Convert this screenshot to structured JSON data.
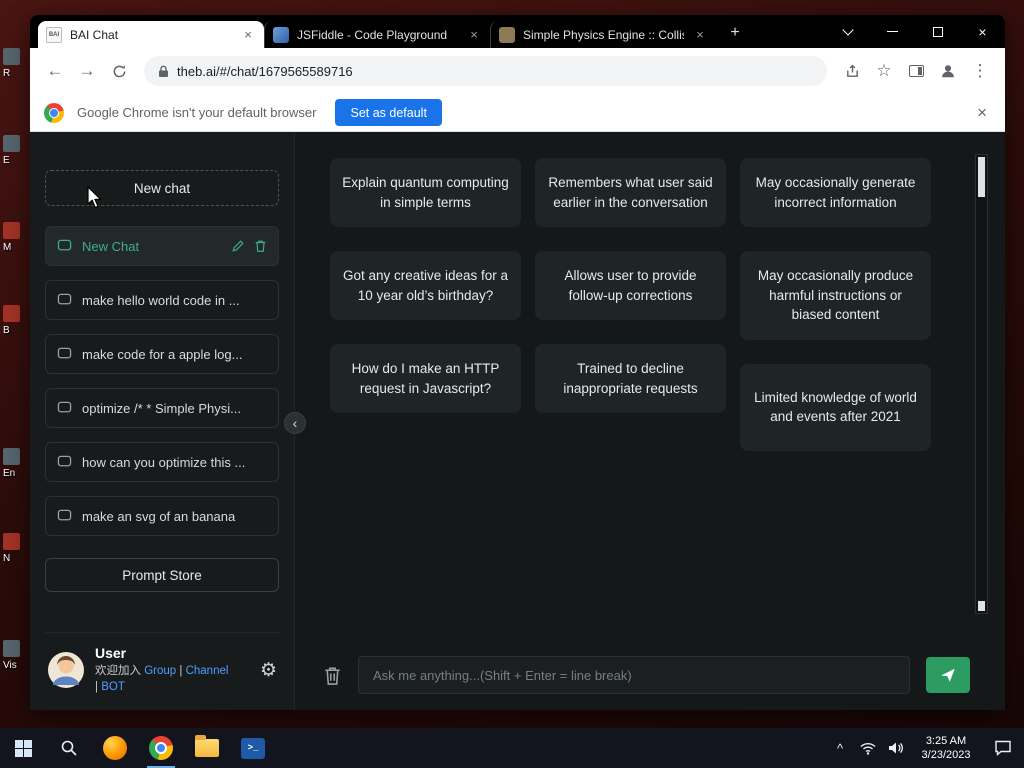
{
  "window": {
    "tabs": [
      {
        "title": "BAI Chat",
        "favicon_text": "BAI"
      },
      {
        "title": "JSFiddle - Code Playground"
      },
      {
        "title": "Simple Physics Engine :: Collision"
      }
    ],
    "url": "theb.ai/#/chat/1679565589716"
  },
  "notification": {
    "message": "Google Chrome isn't your default browser",
    "action": "Set as default"
  },
  "sidebar": {
    "new_chat": "New chat",
    "chats": [
      {
        "label": "New Chat"
      },
      {
        "label": "make hello world code in ..."
      },
      {
        "label": "make code for a apple log..."
      },
      {
        "label": "optimize /* * Simple Physi..."
      },
      {
        "label": "how can you optimize this ..."
      },
      {
        "label": "make an svg of an banana"
      }
    ],
    "prompt_store": "Prompt Store",
    "user": {
      "name": "User",
      "welcome": "欢迎加入",
      "link_group": "Group",
      "link_channel": "Channel",
      "link_bot": "BOT",
      "sep": "|"
    }
  },
  "examples": {
    "col1": [
      "Explain quantum computing in simple terms",
      "Got any creative ideas for a 10 year old’s birthday?",
      "How do I make an HTTP request in Javascript?"
    ],
    "col2": [
      "Remembers what user said earlier in the conversation",
      "Allows user to provide follow-up corrections",
      "Trained to decline inappropriate requests"
    ],
    "col3": [
      "May occasionally generate incorrect information",
      "May occasionally produce harmful instructions or biased content",
      "Limited knowledge of world and events after 2021"
    ]
  },
  "composer": {
    "placeholder": "Ask me anything...(Shift + Enter = line break)"
  },
  "taskbar": {
    "time": "3:25 AM",
    "date": "3/23/2023"
  },
  "desktop_icons": [
    {
      "label": "R"
    },
    {
      "label": "E"
    },
    {
      "label": "M"
    },
    {
      "label": "B"
    },
    {
      "label": "En"
    },
    {
      "label": "N"
    },
    {
      "label": "Vis"
    }
  ],
  "icons": {
    "back": "←",
    "forward": "→",
    "star": "☆",
    "kebab": "⋮",
    "plus": "+",
    "close": "×",
    "tab_close": "×",
    "collapse": "‹",
    "tray_expand": "^",
    "gear": "⚙",
    "powershell": ">_"
  },
  "colors": {
    "accent_blue": "#1a73e8",
    "send_green": "#2d9c62",
    "selected_teal": "#3cae92",
    "link_blue": "#4d9fff"
  }
}
